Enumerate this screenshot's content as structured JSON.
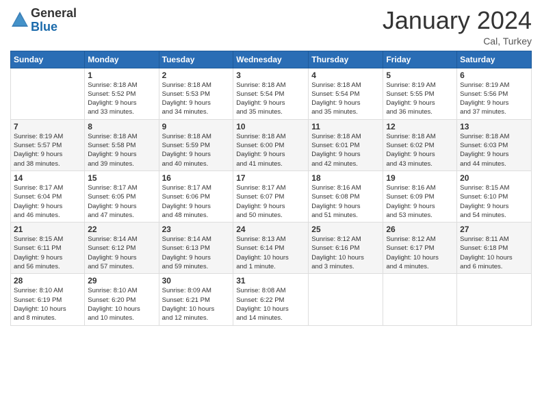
{
  "header": {
    "logo": {
      "line1": "General",
      "line2": "Blue"
    },
    "month_title": "January 2024",
    "subtitle": "Cal, Turkey"
  },
  "weekdays": [
    "Sunday",
    "Monday",
    "Tuesday",
    "Wednesday",
    "Thursday",
    "Friday",
    "Saturday"
  ],
  "weeks": [
    [
      {
        "day": "",
        "info": ""
      },
      {
        "day": "1",
        "info": "Sunrise: 8:18 AM\nSunset: 5:52 PM\nDaylight: 9 hours\nand 33 minutes."
      },
      {
        "day": "2",
        "info": "Sunrise: 8:18 AM\nSunset: 5:53 PM\nDaylight: 9 hours\nand 34 minutes."
      },
      {
        "day": "3",
        "info": "Sunrise: 8:18 AM\nSunset: 5:54 PM\nDaylight: 9 hours\nand 35 minutes."
      },
      {
        "day": "4",
        "info": "Sunrise: 8:18 AM\nSunset: 5:54 PM\nDaylight: 9 hours\nand 35 minutes."
      },
      {
        "day": "5",
        "info": "Sunrise: 8:19 AM\nSunset: 5:55 PM\nDaylight: 9 hours\nand 36 minutes."
      },
      {
        "day": "6",
        "info": "Sunrise: 8:19 AM\nSunset: 5:56 PM\nDaylight: 9 hours\nand 37 minutes."
      }
    ],
    [
      {
        "day": "7",
        "info": "Sunrise: 8:19 AM\nSunset: 5:57 PM\nDaylight: 9 hours\nand 38 minutes."
      },
      {
        "day": "8",
        "info": "Sunrise: 8:18 AM\nSunset: 5:58 PM\nDaylight: 9 hours\nand 39 minutes."
      },
      {
        "day": "9",
        "info": "Sunrise: 8:18 AM\nSunset: 5:59 PM\nDaylight: 9 hours\nand 40 minutes."
      },
      {
        "day": "10",
        "info": "Sunrise: 8:18 AM\nSunset: 6:00 PM\nDaylight: 9 hours\nand 41 minutes."
      },
      {
        "day": "11",
        "info": "Sunrise: 8:18 AM\nSunset: 6:01 PM\nDaylight: 9 hours\nand 42 minutes."
      },
      {
        "day": "12",
        "info": "Sunrise: 8:18 AM\nSunset: 6:02 PM\nDaylight: 9 hours\nand 43 minutes."
      },
      {
        "day": "13",
        "info": "Sunrise: 8:18 AM\nSunset: 6:03 PM\nDaylight: 9 hours\nand 44 minutes."
      }
    ],
    [
      {
        "day": "14",
        "info": "Sunrise: 8:17 AM\nSunset: 6:04 PM\nDaylight: 9 hours\nand 46 minutes."
      },
      {
        "day": "15",
        "info": "Sunrise: 8:17 AM\nSunset: 6:05 PM\nDaylight: 9 hours\nand 47 minutes."
      },
      {
        "day": "16",
        "info": "Sunrise: 8:17 AM\nSunset: 6:06 PM\nDaylight: 9 hours\nand 48 minutes."
      },
      {
        "day": "17",
        "info": "Sunrise: 8:17 AM\nSunset: 6:07 PM\nDaylight: 9 hours\nand 50 minutes."
      },
      {
        "day": "18",
        "info": "Sunrise: 8:16 AM\nSunset: 6:08 PM\nDaylight: 9 hours\nand 51 minutes."
      },
      {
        "day": "19",
        "info": "Sunrise: 8:16 AM\nSunset: 6:09 PM\nDaylight: 9 hours\nand 53 minutes."
      },
      {
        "day": "20",
        "info": "Sunrise: 8:15 AM\nSunset: 6:10 PM\nDaylight: 9 hours\nand 54 minutes."
      }
    ],
    [
      {
        "day": "21",
        "info": "Sunrise: 8:15 AM\nSunset: 6:11 PM\nDaylight: 9 hours\nand 56 minutes."
      },
      {
        "day": "22",
        "info": "Sunrise: 8:14 AM\nSunset: 6:12 PM\nDaylight: 9 hours\nand 57 minutes."
      },
      {
        "day": "23",
        "info": "Sunrise: 8:14 AM\nSunset: 6:13 PM\nDaylight: 9 hours\nand 59 minutes."
      },
      {
        "day": "24",
        "info": "Sunrise: 8:13 AM\nSunset: 6:14 PM\nDaylight: 10 hours\nand 1 minute."
      },
      {
        "day": "25",
        "info": "Sunrise: 8:12 AM\nSunset: 6:16 PM\nDaylight: 10 hours\nand 3 minutes."
      },
      {
        "day": "26",
        "info": "Sunrise: 8:12 AM\nSunset: 6:17 PM\nDaylight: 10 hours\nand 4 minutes."
      },
      {
        "day": "27",
        "info": "Sunrise: 8:11 AM\nSunset: 6:18 PM\nDaylight: 10 hours\nand 6 minutes."
      }
    ],
    [
      {
        "day": "28",
        "info": "Sunrise: 8:10 AM\nSunset: 6:19 PM\nDaylight: 10 hours\nand 8 minutes."
      },
      {
        "day": "29",
        "info": "Sunrise: 8:10 AM\nSunset: 6:20 PM\nDaylight: 10 hours\nand 10 minutes."
      },
      {
        "day": "30",
        "info": "Sunrise: 8:09 AM\nSunset: 6:21 PM\nDaylight: 10 hours\nand 12 minutes."
      },
      {
        "day": "31",
        "info": "Sunrise: 8:08 AM\nSunset: 6:22 PM\nDaylight: 10 hours\nand 14 minutes."
      },
      {
        "day": "",
        "info": ""
      },
      {
        "day": "",
        "info": ""
      },
      {
        "day": "",
        "info": ""
      }
    ]
  ]
}
